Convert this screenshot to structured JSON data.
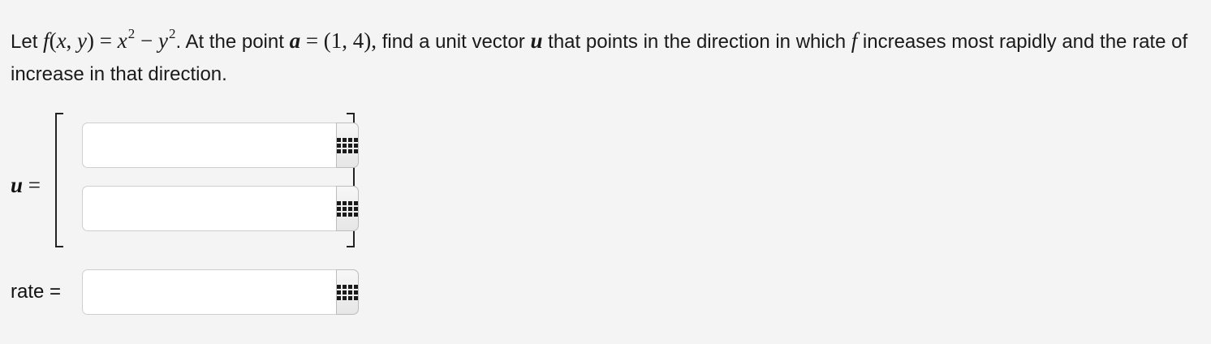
{
  "question": {
    "let": "Let",
    "f": "f",
    "open_paren": "(",
    "x": "x",
    "comma": ", ",
    "y": "y",
    "close_eq": ") = ",
    "x2": "x",
    "exp1": "2",
    "minus": " − ",
    "y2": "y",
    "exp2": "2",
    "text1": ". At the point ",
    "a": "a",
    "eq_point": " = (1, 4),",
    "text2": " find a unit vector ",
    "u": "u",
    "text3": " that points in the direction in which ",
    "f2": "f",
    "text4": " increases most rapidly and the rate of increase in that direction."
  },
  "answer": {
    "u_symbol": "u",
    "u_equals": " =",
    "u_component_1_value": "",
    "u_component_2_value": "",
    "rate_label": "rate =",
    "rate_value": ""
  },
  "icons": {
    "palette": "math-palette-icon"
  }
}
